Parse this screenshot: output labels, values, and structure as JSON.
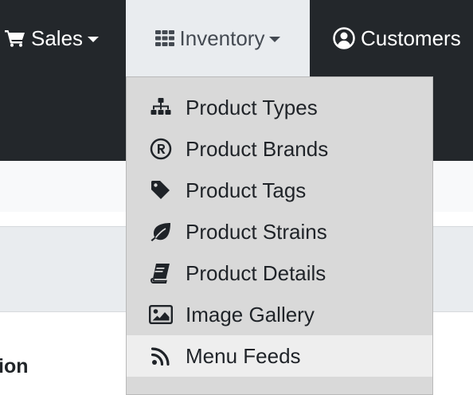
{
  "nav": {
    "sales": {
      "label": "Sales",
      "icon": "shopping-cart-icon"
    },
    "inventory": {
      "label": "Inventory",
      "icon": "grid-icon"
    },
    "customers": {
      "label": "Customers",
      "icon": "user-circle-icon"
    }
  },
  "dropdown": {
    "items": [
      {
        "label": "Product Types",
        "icon": "sitemap-icon"
      },
      {
        "label": "Product Brands",
        "icon": "registered-icon"
      },
      {
        "label": "Product Tags",
        "icon": "tag-icon"
      },
      {
        "label": "Product Strains",
        "icon": "leaf-icon"
      },
      {
        "label": "Product Details",
        "icon": "book-icon"
      },
      {
        "label": "Image Gallery",
        "icon": "image-icon"
      },
      {
        "label": "Menu Feeds",
        "icon": "rss-icon",
        "active": true
      }
    ]
  },
  "page": {
    "section_text": "ion"
  },
  "colors": {
    "navbar": "#23272b",
    "inventory_active": "#e9ecef",
    "dropdown_bg": "#d9d9d9",
    "dropdown_active": "#eeeeee"
  }
}
